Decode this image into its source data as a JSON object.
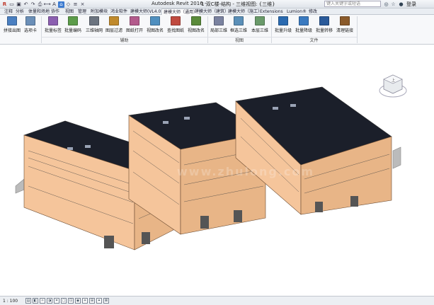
{
  "window": {
    "app_title": "Autodesk Revit 2016 -",
    "file_title": "1 双C楼-结构 - 三维视图: {三维}",
    "search_placeholder": "键入关键字或短语",
    "login_label": "登录",
    "accent_color": "#3d7bd0"
  },
  "quick_access": {
    "icons": [
      "revit-logo-icon",
      "open-icon",
      "save-icon",
      "undo-icon",
      "redo-icon",
      "print-icon",
      "measure-icon",
      "text-icon",
      "3d-view-icon",
      "section-icon",
      "thin-lines-icon",
      "close-icon"
    ]
  },
  "tabs": [
    {
      "label": "注释"
    },
    {
      "label": "分析"
    },
    {
      "label": "体量和场地"
    },
    {
      "label": "协作"
    },
    {
      "label": "视图"
    },
    {
      "label": "管理"
    },
    {
      "label": "附加模块"
    },
    {
      "label": "鸿业软件"
    },
    {
      "label": "建模大师(VL4.0)"
    },
    {
      "label": "建模大师（通用）"
    },
    {
      "label": "建模大师（建筑）"
    },
    {
      "label": "建模大师（施工）"
    },
    {
      "label": "Extensions"
    },
    {
      "label": "Lumion®"
    },
    {
      "label": "修改"
    }
  ],
  "ribbon": {
    "buttons": [
      {
        "label": "拼接出图",
        "icon": "tile-sheet-icon",
        "color": "#4a7fc1"
      },
      {
        "label": "选项卡",
        "icon": "tabs-icon",
        "color": "#6b8fb8"
      },
      {
        "label": "批量标签",
        "icon": "batch-tag-icon",
        "color": "#8b5fb0"
      },
      {
        "label": "批量编码",
        "icon": "batch-code-icon",
        "color": "#5c9c4a"
      },
      {
        "label": "三维轴网",
        "icon": "3d-grid-icon",
        "color": "#6c7480"
      },
      {
        "label": "图层过滤",
        "icon": "layer-filter-icon",
        "color": "#c08a2c"
      },
      {
        "label": "图纸打开",
        "icon": "sheet-open-icon",
        "color": "#b35a8c"
      },
      {
        "label": "视图改名",
        "icon": "view-rename-icon",
        "color": "#4f8fbf"
      },
      {
        "label": "查找图纸",
        "icon": "find-sheet-icon",
        "color": "#c04a3f"
      },
      {
        "label": "视图改名",
        "icon": "view-rename-icon-2",
        "color": "#5a8a3a"
      },
      {
        "label": "局部三维",
        "icon": "local-3d-icon",
        "color": "#7a82a0"
      },
      {
        "label": "框选三维",
        "icon": "box-3d-icon",
        "color": "#5a8fb8"
      },
      {
        "label": "本层三维",
        "icon": "floor-3d-icon",
        "color": "#6a9a6a"
      },
      {
        "label": "批量升级",
        "icon": "batch-upgrade-icon",
        "color": "#2a6ab0"
      },
      {
        "label": "批量降级",
        "icon": "batch-downgrade-icon",
        "color": "#3a7ac0"
      },
      {
        "label": "批量转移",
        "icon": "batch-transfer-icon",
        "color": "#2a5a9a"
      },
      {
        "label": "清理链接",
        "icon": "clean-link-icon",
        "color": "#8a5a2a"
      }
    ],
    "panels": [
      {
        "label": "辅助"
      },
      {
        "label": "视图"
      },
      {
        "label": "文件"
      }
    ]
  },
  "status": {
    "scale": "1 : 100",
    "icons": [
      "detail-level-icon",
      "visual-style-icon",
      "sun-path-icon",
      "shadows-icon",
      "crop-icon",
      "show-crop-icon",
      "unlock-3d-icon",
      "temp-hide-icon",
      "reveal-hidden-icon",
      "analytical-model-icon",
      "highlight-icon",
      "constraints-icon"
    ]
  },
  "viewcube": {
    "face_label": "上"
  },
  "watermark": "www.zhulong.com"
}
